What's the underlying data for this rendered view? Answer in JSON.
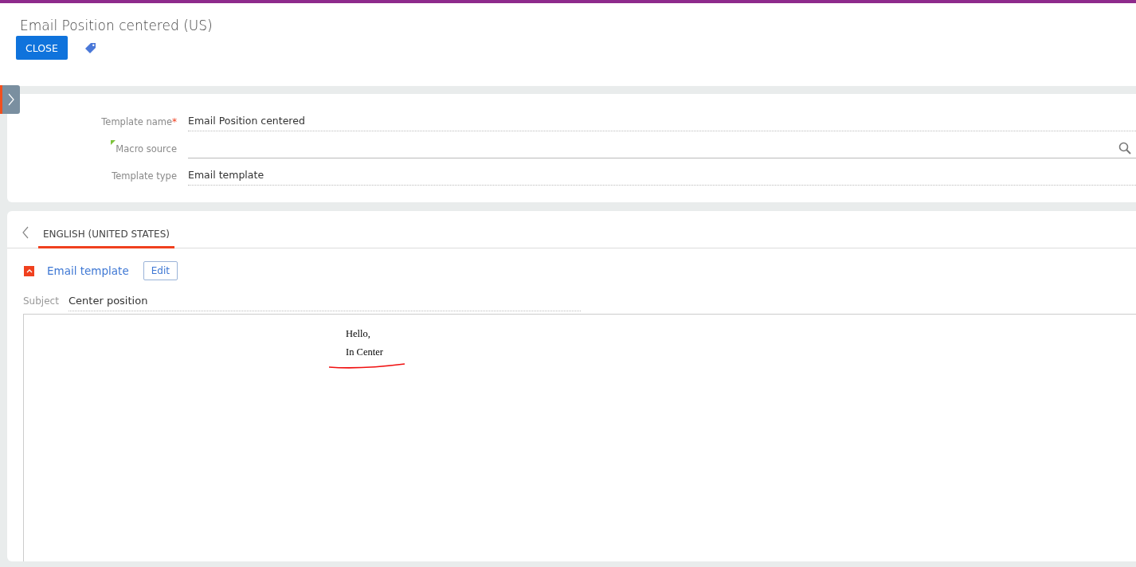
{
  "page": {
    "title": "Email Position centered (US)"
  },
  "toolbar": {
    "buttons": [
      {
        "label": "CLOSE",
        "kind": "primary"
      }
    ]
  },
  "fields": [
    {
      "label": "Template name",
      "value": "Email Position centered",
      "required_mark": "*",
      "kind": "text"
    },
    {
      "label": "Macro source",
      "kind": "lookup"
    },
    {
      "label": "Template type",
      "value": "Email template",
      "kind": "text"
    }
  ],
  "tabs": [
    {
      "label": "ENGLISH (UNITED STATES)",
      "selected": true
    }
  ],
  "section": {
    "title": "Email template",
    "expanded": true,
    "edit_button": "Edit"
  },
  "subject": {
    "label": "Subject",
    "value": "Center position"
  },
  "body": {
    "lines": [
      "Hello,",
      "In Center"
    ]
  }
}
